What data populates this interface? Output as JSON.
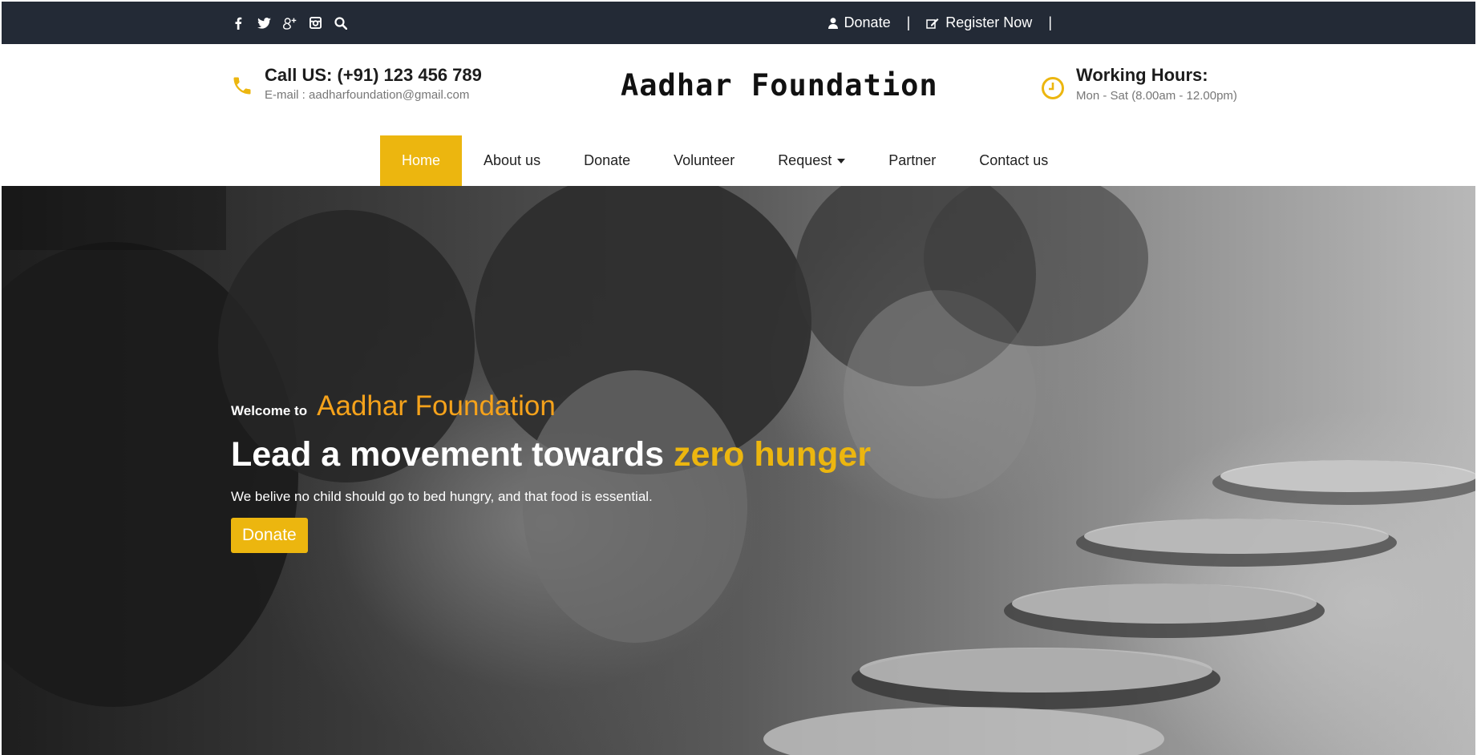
{
  "topbar": {
    "social_icons": [
      "facebook-icon",
      "twitter-icon",
      "google-plus-icon",
      "instagram-icon",
      "search-icon"
    ],
    "donate_label": "Donate",
    "register_label": "Register Now",
    "separator": "|"
  },
  "header": {
    "call_title": "Call US: (+91) 123 456 789",
    "email": "E-mail : aadharfoundation@gmail.com",
    "brand": "Aadhar Foundation",
    "hours_title": "Working Hours:",
    "hours_sub": "Mon - Sat (8.00am - 12.00pm)"
  },
  "nav": {
    "items": [
      {
        "label": "Home"
      },
      {
        "label": "About us"
      },
      {
        "label": "Donate"
      },
      {
        "label": "Volunteer"
      },
      {
        "label": "Request"
      },
      {
        "label": "Partner"
      },
      {
        "label": "Contact us"
      }
    ],
    "active_index": 0
  },
  "hero": {
    "welcome_small": "Welcome to",
    "welcome_big": "Aadhar Foundation",
    "headline_main": "Lead a movement towards",
    "headline_highlight": "zero hunger",
    "subline": "We belive no child should go to bed hungry, and that food is essential.",
    "button_label": "Donate"
  },
  "colors": {
    "topbar_bg": "#232a36",
    "accent": "#ecb60f",
    "orange_text": "#f5a21b"
  }
}
